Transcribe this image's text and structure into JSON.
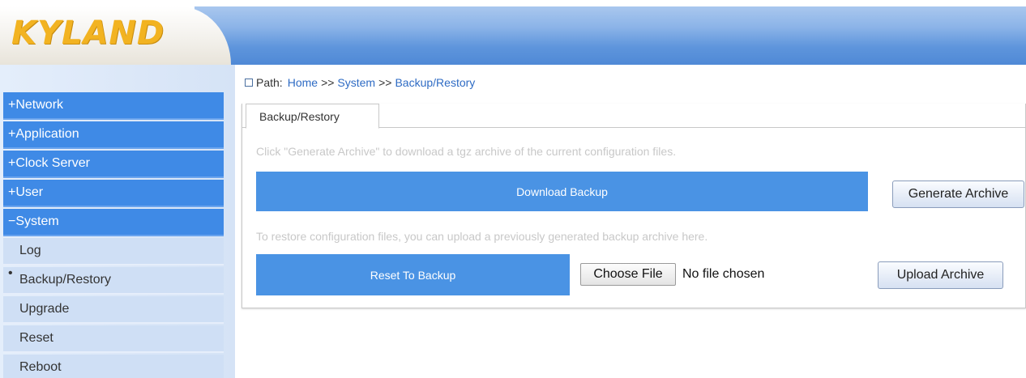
{
  "header": {
    "logo_text": "KYLAND"
  },
  "sidebar": {
    "sections": [
      {
        "label": "+Network"
      },
      {
        "label": "+Application"
      },
      {
        "label": "+Clock Server"
      },
      {
        "label": "+User"
      },
      {
        "label": "−System"
      }
    ],
    "system_items": [
      {
        "label": "Log"
      },
      {
        "label": "Backup/Restory"
      },
      {
        "label": "Upgrade"
      },
      {
        "label": "Reset"
      },
      {
        "label": "Reboot"
      }
    ]
  },
  "path": {
    "label": "Path:",
    "crumbs": [
      "Home",
      "System",
      "Backup/Restory"
    ],
    "separator": ">>"
  },
  "tab": {
    "label": "Backup/Restory"
  },
  "backup": {
    "hint": "Click \"Generate Archive\" to download a tgz archive of the current configuration files.",
    "bar_label": "Download Backup",
    "button_label": "Generate Archive"
  },
  "restore": {
    "hint": "To restore configuration files, you can upload a previously generated backup archive here.",
    "bar_label": "Reset To Backup",
    "choose_label": "Choose File",
    "file_status": "No file chosen",
    "button_label": "Upload Archive"
  },
  "colors": {
    "nav_blue": "#3f8ae6",
    "bar_blue": "#4a93e4",
    "logo": "#f2b321",
    "link": "#2e6bc4"
  }
}
